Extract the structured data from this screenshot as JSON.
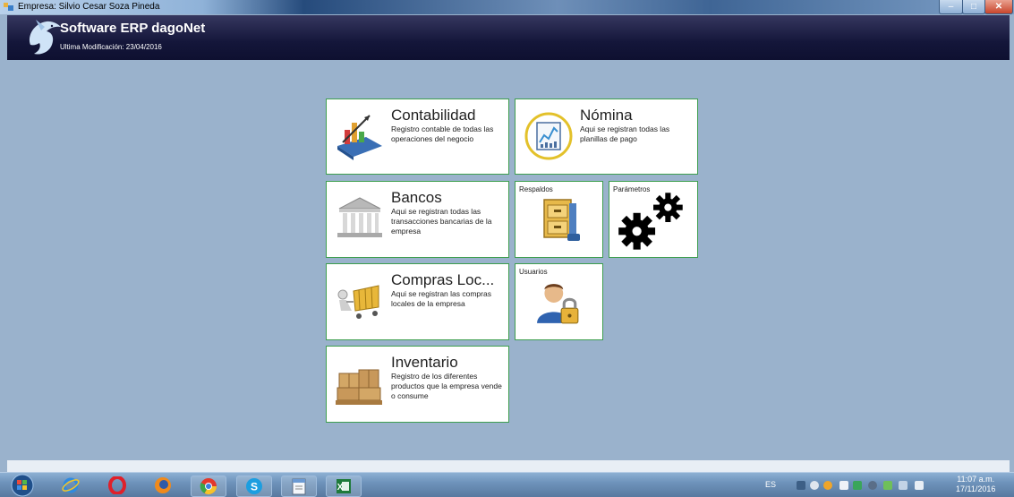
{
  "window": {
    "title": "Empresa: Silvio Cesar Soza Pineda",
    "controls": [
      "minimize-icon",
      "maximize-icon",
      "close-icon"
    ],
    "close_glyph": "✕",
    "max_glyph": "□",
    "min_glyph": "–"
  },
  "header": {
    "title": "Software ERP dagoNet",
    "subtitle": "Ultima Modificación: 23/04/2016",
    "logo": "dolphin-icon"
  },
  "tiles": {
    "contabilidad": {
      "title": "Contabilidad",
      "desc": "Registro contable de todas las operaciones del negocio",
      "icon": "accounting-chart-icon"
    },
    "nomina": {
      "title": "Nómina",
      "desc": "Aqui se registran todas las planillas de pago",
      "icon": "payroll-document-icon"
    },
    "bancos": {
      "title": "Bancos",
      "desc": "Aqui se registran todas las transacciones bancarias de la empresa",
      "icon": "bank-building-icon"
    },
    "respaldos": {
      "title": "Respaldos",
      "icon": "archive-cabinet-icon"
    },
    "parametros": {
      "title": "Parámetros",
      "icon": "gears-icon"
    },
    "compras": {
      "title": "Compras Loc...",
      "desc": "Aqui se registran las compras locales de la empresa",
      "icon": "shopping-cart-icon"
    },
    "usuarios": {
      "title": "Usuarios",
      "icon": "user-lock-icon"
    },
    "inventario": {
      "title": "Inventario",
      "desc": "Registro de los diferentes productos que la empresa vende o consume",
      "icon": "boxes-pallet-icon"
    }
  },
  "taskbar": {
    "items": [
      "start-orb-icon",
      "internet-explorer-icon",
      "opera-icon",
      "firefox-icon",
      "chrome-icon",
      "skype-icon",
      "notepad-app-icon",
      "excel-app-icon"
    ],
    "lang": "ES",
    "time": "11:07 a.m.",
    "date": "17/11/2016"
  },
  "colors": {
    "tile_border": "#3d9e4e",
    "background": "#9ab2cc",
    "header": "#14163a"
  }
}
